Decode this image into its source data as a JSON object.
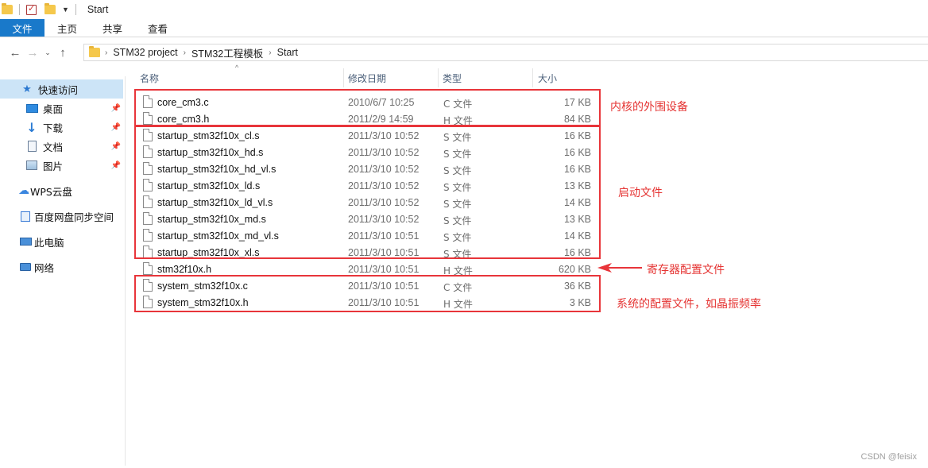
{
  "window": {
    "title": "Start"
  },
  "ribbon": {
    "tabs": [
      "文件",
      "主页",
      "共享",
      "查看"
    ]
  },
  "address": {
    "crumbs": [
      "STM32 project",
      "STM32工程模板",
      "Start"
    ]
  },
  "sidebar": {
    "items": [
      {
        "label": "快速访问",
        "icon": "star-icon"
      },
      {
        "label": "桌面",
        "icon": "desktop-icon",
        "pinned": true
      },
      {
        "label": "下载",
        "icon": "download-icon",
        "pinned": true
      },
      {
        "label": "文档",
        "icon": "document-icon",
        "pinned": true
      },
      {
        "label": "图片",
        "icon": "picture-icon",
        "pinned": true
      },
      {
        "label": "WPS云盘",
        "icon": "cloud-icon"
      },
      {
        "label": "百度网盘同步空间",
        "icon": "baidu-netdisk-icon"
      },
      {
        "label": "此电脑",
        "icon": "computer-icon"
      },
      {
        "label": "网络",
        "icon": "network-icon"
      }
    ]
  },
  "columns": {
    "name": "名称",
    "date": "修改日期",
    "type": "类型",
    "size": "大小"
  },
  "files": [
    {
      "name": "core_cm3.c",
      "date": "2010/6/7 10:25",
      "type": "C 文件",
      "size": "17 KB"
    },
    {
      "name": "core_cm3.h",
      "date": "2011/2/9 14:59",
      "type": "H 文件",
      "size": "84 KB"
    },
    {
      "name": "startup_stm32f10x_cl.s",
      "date": "2011/3/10 10:52",
      "type": "S 文件",
      "size": "16 KB"
    },
    {
      "name": "startup_stm32f10x_hd.s",
      "date": "2011/3/10 10:52",
      "type": "S 文件",
      "size": "16 KB"
    },
    {
      "name": "startup_stm32f10x_hd_vl.s",
      "date": "2011/3/10 10:52",
      "type": "S 文件",
      "size": "16 KB"
    },
    {
      "name": "startup_stm32f10x_ld.s",
      "date": "2011/3/10 10:52",
      "type": "S 文件",
      "size": "13 KB"
    },
    {
      "name": "startup_stm32f10x_ld_vl.s",
      "date": "2011/3/10 10:52",
      "type": "S 文件",
      "size": "14 KB"
    },
    {
      "name": "startup_stm32f10x_md.s",
      "date": "2011/3/10 10:52",
      "type": "S 文件",
      "size": "13 KB"
    },
    {
      "name": "startup_stm32f10x_md_vl.s",
      "date": "2011/3/10 10:51",
      "type": "S 文件",
      "size": "14 KB"
    },
    {
      "name": "startup_stm32f10x_xl.s",
      "date": "2011/3/10 10:51",
      "type": "S 文件",
      "size": "16 KB"
    },
    {
      "name": "stm32f10x.h",
      "date": "2011/3/10 10:51",
      "type": "H 文件",
      "size": "620 KB"
    },
    {
      "name": "system_stm32f10x.c",
      "date": "2011/3/10 10:51",
      "type": "C 文件",
      "size": "36 KB"
    },
    {
      "name": "system_stm32f10x.h",
      "date": "2011/3/10 10:51",
      "type": "H 文件",
      "size": "3 KB"
    }
  ],
  "annotations": {
    "core": "内核的外围设备",
    "startup": "启动文件",
    "register": "寄存器配置文件",
    "system": "系统的配置文件，如晶振频率",
    "color": "#e8353a"
  },
  "watermark": "CSDN @feisix"
}
